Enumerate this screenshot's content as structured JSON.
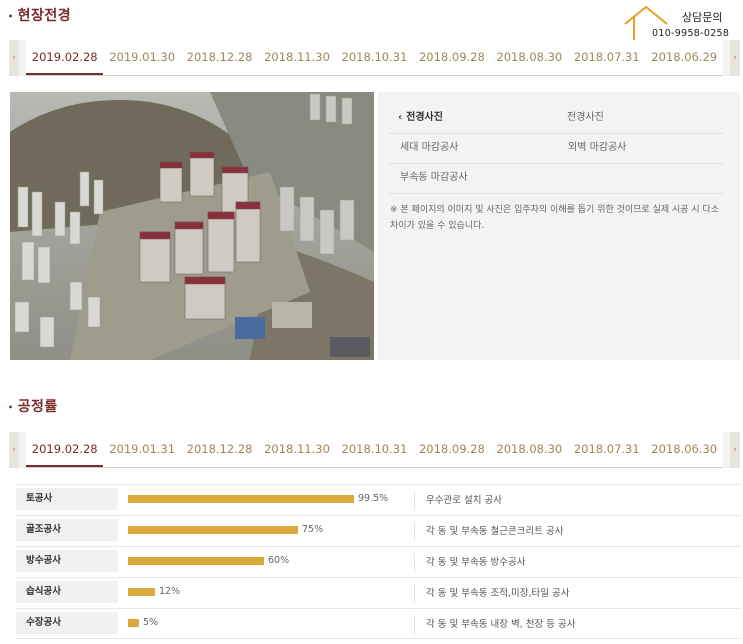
{
  "site_photo_section": {
    "title": "현장전경",
    "tabs": [
      "2019.02.28",
      "2019.01.30",
      "2018.12.28",
      "2018.11.30",
      "2018.10.31",
      "2018.09.28",
      "2018.08.30",
      "2018.07.31",
      "2018.06.29"
    ],
    "active_tab": 0,
    "menu": [
      [
        "전경사진",
        "전경사진"
      ],
      [
        "세대 마감공사",
        "외벽 마감공사"
      ],
      [
        "부속동 마감공사",
        ""
      ]
    ],
    "notice": "※ 본 페이지의 이미지 및 사진은 입주자의 이해를 돕기 위한 것이므로 실제 시공 시 다소 차이가 있을 수 있습니다."
  },
  "contact": {
    "title": "상담문의",
    "phone": "010-9958-0258"
  },
  "progress_section": {
    "title": "공정률",
    "tabs": [
      "2019.02.28",
      "2019.01.31",
      "2018.12.28",
      "2018.11.30",
      "2018.10.31",
      "2018.09.28",
      "2018.08.30",
      "2018.07.31",
      "2018.06.30"
    ],
    "active_tab": 0,
    "items": [
      {
        "name": "토공사",
        "percent": 99.5,
        "label": "99.5%",
        "desc": "우수관로 설치 공사"
      },
      {
        "name": "골조공사",
        "percent": 75,
        "label": "75%",
        "desc": "각 동 및 부속동 철근콘크리트 공사"
      },
      {
        "name": "방수공사",
        "percent": 60,
        "label": "60%",
        "desc": "각 동 및 부속동 방수공사"
      },
      {
        "name": "습식공사",
        "percent": 12,
        "label": "12%",
        "desc": "각 동 및 부속동 조적,미장,타일 공사"
      },
      {
        "name": "수장공사",
        "percent": 5,
        "label": "5%",
        "desc": "각 동 및 부속동 내장 벽, 천장 등 공사"
      }
    ]
  },
  "colors": {
    "accent": "#7a2a2a",
    "tab_text": "#a08656",
    "bar": "#dcaa3a",
    "contact_icon": "#e8a020"
  },
  "icons": {
    "tab_prev": "chevron-left-icon",
    "tab_next": "chevron-right-icon",
    "contact": "house-outline-icon"
  },
  "arrows": {
    "left": "‹",
    "right": "›"
  }
}
